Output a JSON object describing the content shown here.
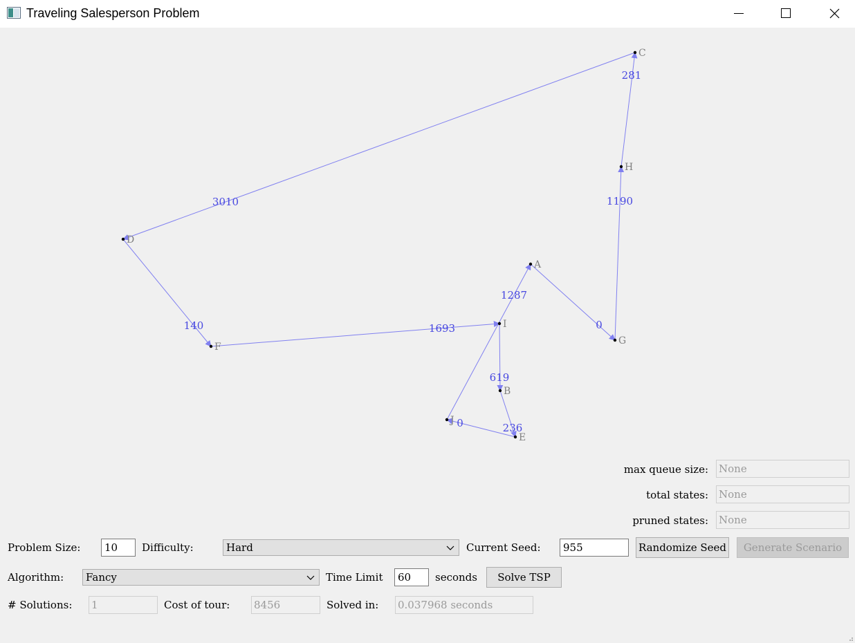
{
  "window": {
    "title": "Traveling Salesperson Problem",
    "controls": [
      "minimize",
      "maximize",
      "close"
    ]
  },
  "graph": {
    "nodes": [
      {
        "id": "C",
        "label": "C"
      },
      {
        "id": "H",
        "label": "H"
      },
      {
        "id": "D",
        "label": "D"
      },
      {
        "id": "A",
        "label": "A"
      },
      {
        "id": "I",
        "label": "I"
      },
      {
        "id": "G",
        "label": "G"
      },
      {
        "id": "F",
        "label": "F"
      },
      {
        "id": "B",
        "label": "B"
      },
      {
        "id": "J",
        "label": "J"
      },
      {
        "id": "E",
        "label": "E"
      }
    ],
    "edges": [
      {
        "from": "D",
        "to": "F",
        "cost": "140"
      },
      {
        "from": "F",
        "to": "I",
        "cost": "1693"
      },
      {
        "from": "I",
        "to": "B",
        "cost": "619"
      },
      {
        "from": "B",
        "to": "E",
        "cost": "236"
      },
      {
        "from": "E",
        "to": "J",
        "cost": "0"
      },
      {
        "from": "J",
        "to": "A",
        "cost": "1287"
      },
      {
        "from": "A",
        "to": "G",
        "cost": "0"
      },
      {
        "from": "G",
        "to": "H",
        "cost": "1190"
      },
      {
        "from": "H",
        "to": "C",
        "cost": "281"
      },
      {
        "from": "C",
        "to": "D",
        "cost": "3010"
      }
    ],
    "edge_color": "#8080f0",
    "cost_label_color": "#4848e0",
    "node_label_color": "#808080"
  },
  "stats": {
    "max_queue_label": "max queue size:",
    "max_queue_value": "None",
    "total_states_label": "total states:",
    "total_states_value": "None",
    "pruned_states_label": "pruned states:",
    "pruned_states_value": "None"
  },
  "controls": {
    "problem_size_label": "Problem Size:",
    "problem_size_value": "10",
    "difficulty_label": "Difficulty:",
    "difficulty_value": "Hard",
    "current_seed_label": "Current Seed:",
    "current_seed_value": "955",
    "randomize_seed_label": "Randomize Seed",
    "generate_scenario_label": "Generate Scenario",
    "algorithm_label": "Algorithm:",
    "algorithm_value": "Fancy",
    "time_limit_label": "Time Limit",
    "time_limit_value": "60",
    "seconds_label": "seconds",
    "solve_label": "Solve TSP"
  },
  "results": {
    "solutions_label": "# Solutions:",
    "solutions_value": "1",
    "cost_label": "Cost of tour:",
    "cost_value": "8456",
    "solved_in_label": "Solved in:",
    "solved_in_value": "0.037968 seconds"
  }
}
